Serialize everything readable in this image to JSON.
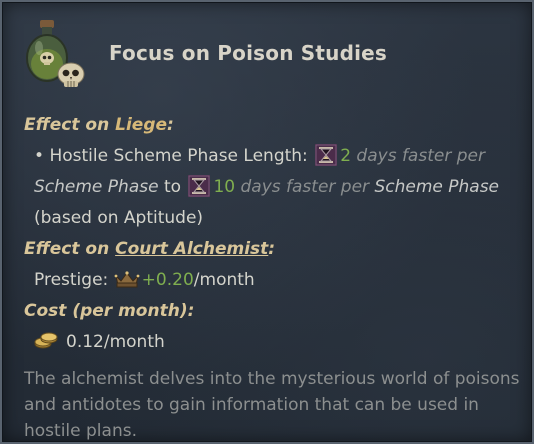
{
  "title": "Focus on Poison Studies",
  "icons": {
    "header": "poison-potion-with-skull-icon",
    "hourglass": "hourglass-icon",
    "prestige": "prestige-crown-icon",
    "gold": "gold-coins-icon"
  },
  "effect_liege": {
    "heading_prefix": "Effect on ",
    "heading_target": "Liege",
    "heading_suffix": ":",
    "bullet": "•",
    "scheme_label": "Hostile Scheme Phase Length:",
    "min_value": "2",
    "faster_text_1": "days faster per",
    "scheme_phase_1": "Scheme Phase",
    "to_word": "to",
    "max_value": "10",
    "faster_text_2": "days faster per",
    "scheme_phase_2": "Scheme Phase",
    "note": "(based on Aptitude)"
  },
  "effect_alchemist": {
    "heading_prefix": "Effect on ",
    "heading_target": "Court Alchemist",
    "heading_suffix": ":",
    "prestige_label": "Prestige:",
    "prestige_value": "+0.20",
    "prestige_unit": "/month"
  },
  "cost": {
    "heading": "Cost (per month):",
    "value": "0.12/month"
  },
  "description": "The alchemist delves into the mysterious world of poisons and antidotes to gain information that can be used in hostile plans.",
  "colors": {
    "accent_green": "#7fae4f",
    "heading_gold": "#d9c69a",
    "body_text": "#d4d4cc",
    "muted_text": "#8c8f8f"
  }
}
